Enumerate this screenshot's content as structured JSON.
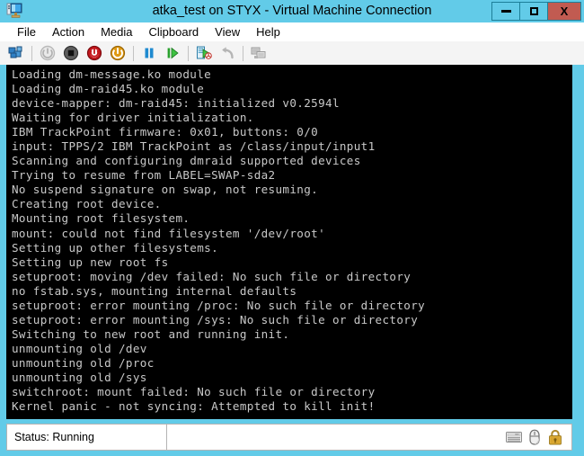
{
  "window": {
    "title": "atka_test on STYX - Virtual Machine Connection",
    "app_icon": "virtual-machine-icon",
    "controls": {
      "minimize": "–",
      "maximize": "□",
      "close": "X"
    },
    "colors": {
      "frame": "#62cbe8",
      "close_button": "#c15b51",
      "toolbar_bg": "#f4f4f4",
      "console_bg": "#000000",
      "console_fg": "#c8c8c8",
      "lock_icon": "#d2a53c"
    }
  },
  "menubar": {
    "items": [
      {
        "label": "File"
      },
      {
        "label": "Action"
      },
      {
        "label": "Media"
      },
      {
        "label": "Clipboard"
      },
      {
        "label": "View"
      },
      {
        "label": "Help"
      }
    ]
  },
  "toolbar": {
    "buttons": [
      {
        "name": "ctrl-alt-delete-icon",
        "tooltip": "Ctrl+Alt+Delete",
        "enabled": true
      },
      {
        "name": "start-icon",
        "tooltip": "Start",
        "enabled": false
      },
      {
        "name": "shutdown-icon",
        "tooltip": "Shut Down",
        "enabled": true
      },
      {
        "name": "turn-off-icon",
        "tooltip": "Turn Off",
        "enabled": true
      },
      {
        "name": "save-state-icon",
        "tooltip": "Save",
        "enabled": true
      },
      {
        "name": "pause-icon",
        "tooltip": "Pause",
        "enabled": true
      },
      {
        "name": "resume-icon",
        "tooltip": "Resume",
        "enabled": true
      },
      {
        "name": "snapshot-icon",
        "tooltip": "Snapshot",
        "enabled": true
      },
      {
        "name": "revert-icon",
        "tooltip": "Revert",
        "enabled": false
      },
      {
        "name": "enhanced-session-icon",
        "tooltip": "Enhanced Session",
        "enabled": false
      }
    ]
  },
  "console": {
    "lines": [
      "Loading dm-message.ko module",
      "Loading dm-raid45.ko module",
      "device-mapper: dm-raid45: initialized v0.2594l",
      "Waiting for driver initialization.",
      "IBM TrackPoint firmware: 0x01, buttons: 0/0",
      "input: TPPS/2 IBM TrackPoint as /class/input/input1",
      "Scanning and configuring dmraid supported devices",
      "Trying to resume from LABEL=SWAP-sda2",
      "No suspend signature on swap, not resuming.",
      "Creating root device.",
      "Mounting root filesystem.",
      "mount: could not find filesystem '/dev/root'",
      "Setting up other filesystems.",
      "Setting up new root fs",
      "setuproot: moving /dev failed: No such file or directory",
      "no fstab.sys, mounting internal defaults",
      "setuproot: error mounting /proc: No such file or directory",
      "setuproot: error mounting /sys: No such file or directory",
      "Switching to new root and running init.",
      "unmounting old /dev",
      "unmounting old /proc",
      "unmounting old /sys",
      "switchroot: mount failed: No such file or directory",
      "Kernel panic - not syncing: Attempted to kill init!"
    ]
  },
  "statusbar": {
    "status_label": "Status: Running",
    "icons": [
      {
        "name": "keyboard-icon",
        "tooltip": "Keyboard input captured"
      },
      {
        "name": "mouse-icon",
        "tooltip": "Mouse input captured"
      },
      {
        "name": "lock-icon",
        "tooltip": "Secure connection"
      }
    ]
  }
}
